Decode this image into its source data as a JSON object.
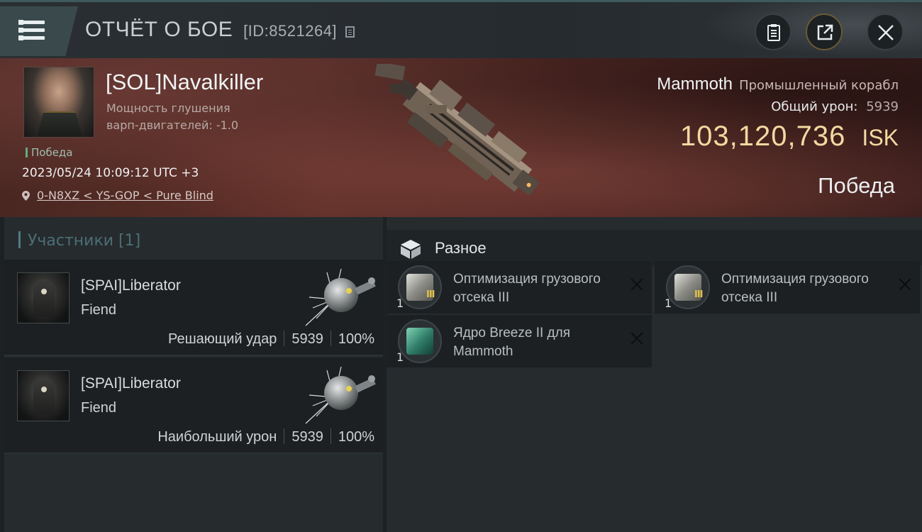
{
  "header": {
    "title": "ОТЧЁТ О БОЕ",
    "report_id": "[ID:8521264]"
  },
  "victim": {
    "pilot_name": "[SOL]Navalkiller",
    "stat_line1": "Мощность глушения",
    "stat_line2": "варп-двигателей: -1.0",
    "win_tag": "Победа",
    "datetime": "2023/05/24 10:09:12 UTC +3",
    "location": "0-N8XZ < YS-GOP < Pure Blind",
    "ship_name": "Mammoth",
    "ship_class": "Промышленный корабл",
    "total_damage_label": "Общий урон:",
    "total_damage": "5939",
    "isk_value": "103,120,736",
    "isk_unit": "ISK",
    "result": "Победа"
  },
  "participants": {
    "header": "Участники [1]",
    "cards": [
      {
        "name": "[SPAI]Liberator",
        "ship": "Fiend",
        "role": "Решающий удар",
        "damage": "5939",
        "percent": "100%"
      },
      {
        "name": "[SPAI]Liberator",
        "ship": "Fiend",
        "role": "Наибольший урон",
        "damage": "5939",
        "percent": "100%"
      }
    ]
  },
  "misc": {
    "header": "Разное",
    "items": [
      {
        "qty": "1",
        "tier": "III",
        "name": "Оптимизация грузового отсека III",
        "icon": "cargo-rig-icon"
      },
      {
        "qty": "1",
        "tier": "III",
        "name": "Оптимизация грузового отсека III",
        "icon": "cargo-rig-icon"
      },
      {
        "qty": "1",
        "tier": "",
        "name": "Ядро Breeze II для Mammoth",
        "icon": "breeze-core-icon"
      }
    ]
  },
  "colors": {
    "accent_teal": "#4f7c83",
    "isk_gold": "#f3d9a0",
    "victory_green": "#5fae82",
    "hero_red": "#5e2f28"
  }
}
